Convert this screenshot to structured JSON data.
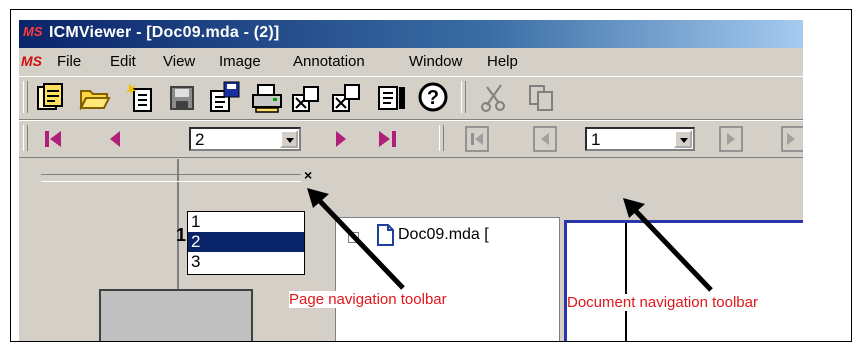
{
  "window": {
    "app_logo": "MS",
    "title": "ICMViewer - [Doc09.mda - (2)]"
  },
  "menubar": {
    "logo": "MS",
    "items": [
      "File",
      "Edit",
      "View",
      "Image",
      "Annotation",
      "Window",
      "Help"
    ]
  },
  "page_nav": {
    "buttons": [
      "first-page-icon",
      "previous-page-icon",
      "next-page-icon",
      "last-page-icon"
    ],
    "combo_value": "2",
    "options": [
      "1",
      "2",
      "3"
    ],
    "selected_option": "2"
  },
  "doc_nav": {
    "buttons": [
      "first-document-icon",
      "previous-document-icon",
      "next-document-icon",
      "last-document-icon"
    ],
    "combo_value": "1"
  },
  "left_pane": {
    "thumbnail_label": "1",
    "close_glyph": "×"
  },
  "tree": {
    "expander": "+",
    "item": "Doc09.mda ["
  },
  "callouts": {
    "page": "Page navigation toolbar",
    "document": "Document navigation toolbar"
  },
  "colors": {
    "titlebar_start": "#0a246a",
    "titlebar_end": "#a6caf0",
    "callout_text": "#e0181c",
    "selection": "#0a246a",
    "nav_arrow": "#b0207a"
  }
}
